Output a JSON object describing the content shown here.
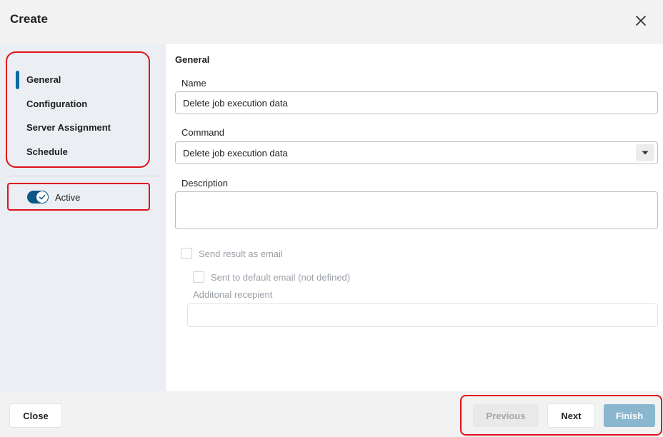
{
  "dialog": {
    "title": "Create"
  },
  "sidebar": {
    "items": [
      {
        "label": "General",
        "selected": true
      },
      {
        "label": "Configuration",
        "selected": false
      },
      {
        "label": "Server Assignment",
        "selected": false
      },
      {
        "label": "Schedule",
        "selected": false
      }
    ],
    "active_toggle": {
      "label": "Active",
      "on": true
    }
  },
  "form": {
    "section_title": "General",
    "name": {
      "label": "Name",
      "value": "Delete job execution data"
    },
    "command": {
      "label": "Command",
      "value": "Delete job execution data"
    },
    "description": {
      "label": "Description",
      "value": ""
    },
    "send_email": {
      "label": "Send result as email",
      "checked": false
    },
    "default_email": {
      "label": "Sent to default email (not defined)",
      "checked": false
    },
    "additional_recipient": {
      "label": "Additonal recepient",
      "value": ""
    }
  },
  "footer": {
    "close_label": "Close",
    "previous_label": "Previous",
    "next_label": "Next",
    "finish_label": "Finish"
  },
  "colors": {
    "accent": "#0d6aa3",
    "highlight_frame": "#e0121c",
    "finish_disabled": "#8ab6cf"
  }
}
